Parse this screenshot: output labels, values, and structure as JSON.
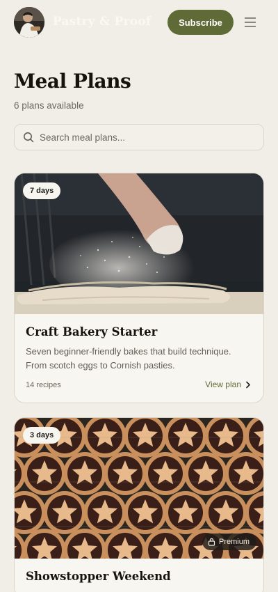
{
  "header": {
    "brand": "Pastry & Proof",
    "subscribe_label": "Subscribe"
  },
  "page": {
    "title": "Meal Plans",
    "subtitle": "6 plans available"
  },
  "search": {
    "placeholder": "Search meal plans..."
  },
  "plans": [
    {
      "duration": "7 days",
      "title": "Craft Bakery Starter",
      "description": "Seven beginner-friendly bakes that build technique. From scotch eggs to Cornish pasties.",
      "recipes": "14 recipes",
      "action": "View plan",
      "image": "hand-dusting-flour-over-dough"
    },
    {
      "duration": "3 days",
      "title": "Showstopper Weekend",
      "premium_label": "Premium",
      "image": "star-topped-mince-pies-on-rack"
    }
  ],
  "colors": {
    "background": "#f1eee8",
    "accent": "#5f6b37",
    "card": "#f8f6f1"
  }
}
